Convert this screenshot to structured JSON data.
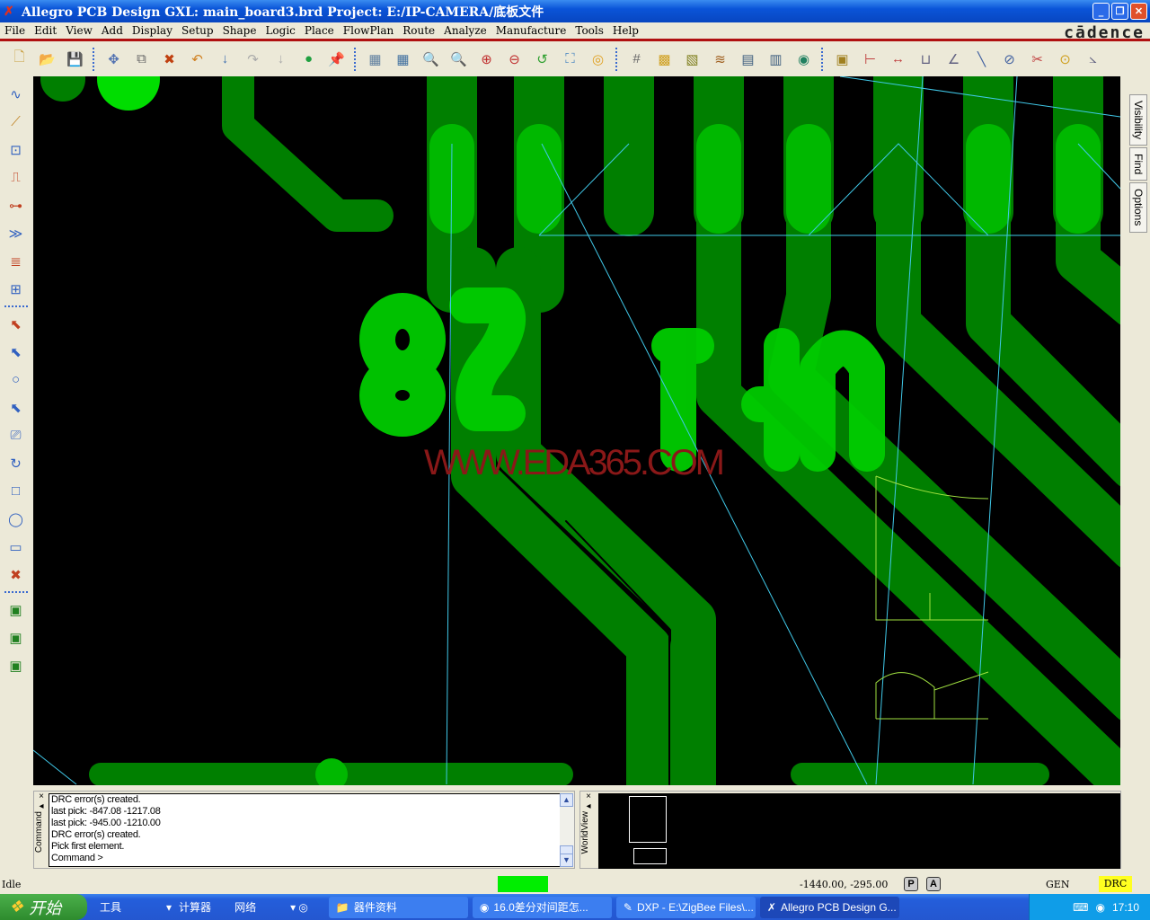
{
  "window": {
    "title": "Allegro PCB Design GXL: main_board3.brd  Project: E:/IP-CAMERA/底板文件",
    "brand": "cādence"
  },
  "menu": [
    "File",
    "Edit",
    "View",
    "Add",
    "Display",
    "Setup",
    "Shape",
    "Logic",
    "Place",
    "FlowPlan",
    "Route",
    "Analyze",
    "Manufacture",
    "Tools",
    "Help"
  ],
  "toolbar": [
    [
      "new-file-icon",
      "🗋",
      "#c9a040"
    ],
    [
      "open-folder-icon",
      "📂",
      "#d8a030"
    ],
    [
      "save-icon",
      "💾",
      "#4060a0"
    ],
    "|",
    [
      "move-icon",
      "✥",
      "#5070b0"
    ],
    [
      "copy-icon",
      "⧉",
      "#666"
    ],
    [
      "delete-icon",
      "✖",
      "#c04010"
    ],
    [
      "undo-icon",
      "↶",
      "#d08020"
    ],
    [
      "undo-down-icon",
      "↓",
      "#4070b0"
    ],
    [
      "redo-icon",
      "↷",
      "#aaa"
    ],
    [
      "redo-down-icon",
      "↓",
      "#aaa"
    ],
    [
      "shadow-toggle-icon",
      "●",
      "#20a040"
    ],
    [
      "pin-icon",
      "📌",
      "#30a030"
    ],
    "|",
    [
      "grid-toggle-icon",
      "▦",
      "#6080a0"
    ],
    [
      "redraw-icon",
      "▦",
      "#4070a0"
    ],
    [
      "zoom-points-icon",
      "🔍",
      "#6080c0"
    ],
    [
      "zoom-fit-icon",
      "🔍",
      "#6080c0"
    ],
    [
      "zoom-in-icon",
      "⊕",
      "#c03030"
    ],
    [
      "zoom-out-icon",
      "⊖",
      "#c03030"
    ],
    [
      "zoom-previous-icon",
      "↺",
      "#30a030"
    ],
    [
      "zoom-world-icon",
      "⛶",
      "#4080c0"
    ],
    [
      "refresh-icon",
      "◎",
      "#e0a020"
    ],
    "|",
    [
      "grid-icon",
      "#",
      "#666"
    ],
    [
      "color-icon",
      "▩",
      "#d0a020"
    ],
    [
      "layer-icon",
      "▧",
      "#808020"
    ],
    [
      "layers-icon",
      "≋",
      "#a06020"
    ],
    [
      "cm-icon",
      "▤",
      "#406080"
    ],
    [
      "dfa-icon",
      "▥",
      "#406080"
    ],
    [
      "3d-view-icon",
      "◉",
      "#208060"
    ],
    "|",
    [
      "spreadsheet-icon",
      "▣",
      "#a08020"
    ],
    [
      "dimension-icon",
      "⊢",
      "#c04040"
    ],
    [
      "measure-icon",
      "↔",
      "#c04040"
    ],
    [
      "ruler-icon",
      "⊔",
      "#606080"
    ],
    [
      "angle-icon",
      "∠",
      "#606080"
    ],
    [
      "line-icon",
      "╲",
      "#4060a0"
    ],
    [
      "circle-tool-icon",
      "⊘",
      "#4060a0"
    ],
    [
      "cross-icon",
      "✂",
      "#c04040"
    ],
    [
      "query-icon",
      "⊙",
      "#d0a020"
    ],
    [
      "slope-icon",
      "⦣",
      "#606080"
    ]
  ],
  "lefttoolbar": [
    [
      "add-connect-icon",
      "∿",
      "#3060c0"
    ],
    [
      "slide-icon",
      "⟋",
      "#c08020"
    ],
    [
      "delay-tune-icon",
      "⊡",
      "#3060c0"
    ],
    [
      "custom-smooth-icon",
      "⎍",
      "#c04020"
    ],
    [
      "vertex-icon",
      "⊶",
      "#c04020"
    ],
    [
      "spread-icon",
      "≫",
      "#3060c0"
    ],
    [
      "bus-route-icon",
      "≣",
      "#c04020"
    ],
    [
      "auto-route-icon",
      "⊞",
      "#3060c0"
    ],
    "-",
    [
      "select-icon",
      "⬉",
      "#c04020"
    ],
    [
      "move-select-icon",
      "⬉",
      "#3060c0"
    ],
    [
      "circle-icon",
      "○",
      "#3060c0"
    ],
    [
      "pick-icon",
      "⬉",
      "#3060c0"
    ],
    [
      "shape-edit-icon",
      "⎚",
      "#3060c0"
    ],
    [
      "rotate-icon",
      "↻",
      "#3060c0"
    ],
    [
      "rectangle-icon",
      "□",
      "#3060c0"
    ],
    [
      "circle-shape-icon",
      "◯",
      "#3060c0"
    ],
    [
      "shape-fill-icon",
      "▭",
      "#3060c0"
    ],
    [
      "shape-delete-icon",
      "✖",
      "#c04020"
    ],
    "-",
    [
      "place-green-1-icon",
      "▣",
      "#208020"
    ],
    [
      "place-green-2-icon",
      "▣",
      "#208020"
    ],
    [
      "place-green-3-icon",
      "▣",
      "#208020"
    ]
  ],
  "righttabs": [
    "Visibility",
    "Find",
    "Options"
  ],
  "canvas": {
    "watermark": "WWW.EDA365.COM",
    "trace_color": "#007f00",
    "pad_color": "#00c000",
    "ratsnest_color": "#40c8e8",
    "silk_color": "#a0e040"
  },
  "command": {
    "label": "Command",
    "lines": [
      "DRC error(s) created.",
      "last pick:  -847.08  -1217.08",
      "last pick:  -945.00  -1210.00",
      "DRC error(s) created.",
      "Pick first element.",
      "Command >"
    ]
  },
  "worldview": {
    "label": "WorldView"
  },
  "status": {
    "state": "Idle",
    "coords": "-1440.00,  -295.00",
    "p": "P",
    "a": "A",
    "mode": "GEN",
    "drc": "DRC"
  },
  "taskbar": {
    "start": "开始",
    "quick": [
      "工具",
      "计算器",
      "网络"
    ],
    "tasks": [
      "器件资料",
      "16.0差分对间距怎...",
      "DXP - E:\\ZigBee Files\\...",
      "Allegro PCB Design G..."
    ],
    "time": "17:10"
  }
}
